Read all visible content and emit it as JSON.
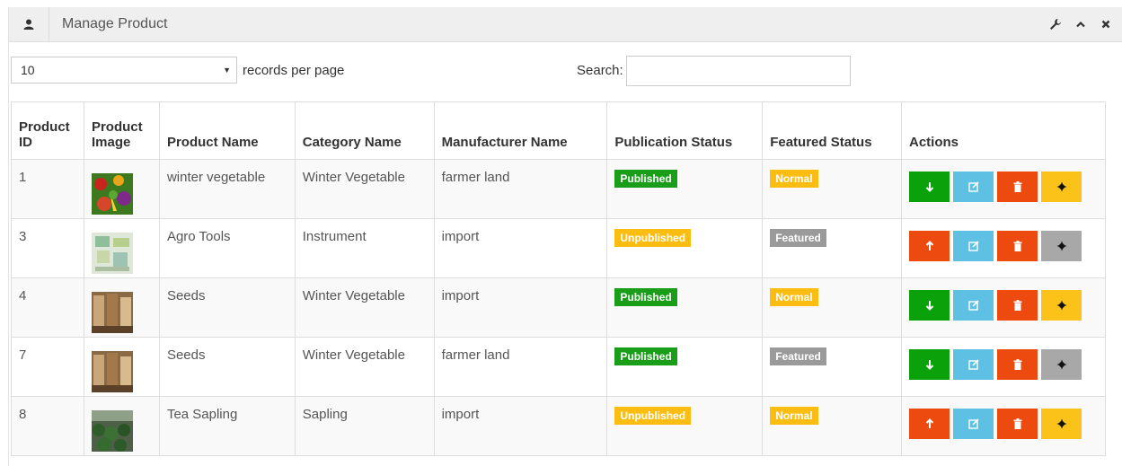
{
  "header": {
    "title": "Manage Product"
  },
  "controls": {
    "page_size": "10",
    "records_per_page_label": "records per page",
    "search_label": "Search:",
    "search_value": ""
  },
  "table": {
    "columns": {
      "id_line1": "Product",
      "id_line2": "ID",
      "image_line1": "Product",
      "image_line2": "Image",
      "name": "Product Name",
      "category": "Category Name",
      "manufacturer": "Manufacturer Name",
      "publication": "Publication Status",
      "featured": "Featured Status",
      "actions": "Actions"
    },
    "rows": [
      {
        "id": "1",
        "name": "winter vegetable",
        "category": "Winter Vegetable",
        "manufacturer": "farmer land",
        "publication": "Published",
        "featured": "Normal"
      },
      {
        "id": "3",
        "name": "Agro Tools",
        "category": "Instrument",
        "manufacturer": "import",
        "publication": "Unpublished",
        "featured": "Featured"
      },
      {
        "id": "4",
        "name": "Seeds",
        "category": "Winter Vegetable",
        "manufacturer": "import",
        "publication": "Published",
        "featured": "Normal"
      },
      {
        "id": "7",
        "name": "Seeds",
        "category": "Winter Vegetable",
        "manufacturer": "farmer land",
        "publication": "Published",
        "featured": "Featured"
      },
      {
        "id": "8",
        "name": "Tea Sapling",
        "category": "Sapling",
        "manufacturer": "import",
        "publication": "Unpublished",
        "featured": "Normal"
      }
    ]
  },
  "colors": {
    "published": "#1a9e1a",
    "unpublished": "#fcbd13",
    "normal": "#fcbd13",
    "featured": "#9a9a9a",
    "btn_unpublish": "#0ba10b",
    "btn_publish": "#ec4a0e",
    "btn_edit": "#5ec0e3",
    "btn_delete": "#ec4a0e",
    "btn_feature_on": "#fbc31a",
    "btn_feature_off": "#a8a8a8"
  },
  "icons": [
    "user-icon",
    "wrench-icon",
    "chevron-up-icon",
    "close-icon",
    "arrow-down-icon",
    "arrow-up-icon",
    "edit-icon",
    "trash-icon",
    "star-icon"
  ]
}
